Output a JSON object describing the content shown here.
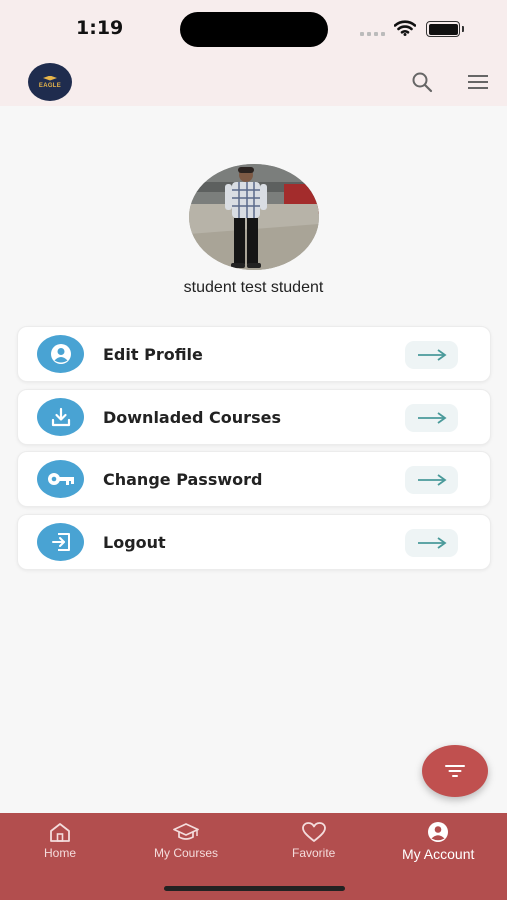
{
  "status_bar": {
    "time": "1:19"
  },
  "header": {
    "logo_text": "EAGLE",
    "search_icon": "search-icon",
    "menu_icon": "hamburger-menu-icon"
  },
  "profile": {
    "name": "student test student"
  },
  "menu": {
    "items": [
      {
        "label": "Edit Profile",
        "icon": "user-circle-icon"
      },
      {
        "label": "Downladed Courses",
        "icon": "download-icon"
      },
      {
        "label": "Change Password",
        "icon": "key-icon"
      },
      {
        "label": "Logout",
        "icon": "logout-icon"
      }
    ]
  },
  "fab": {
    "icon": "filter-icon"
  },
  "bottom_nav": {
    "items": [
      {
        "label": "Home",
        "icon": "home-icon"
      },
      {
        "label": "My Courses",
        "icon": "graduation-cap-icon"
      },
      {
        "label": "Favorite",
        "icon": "heart-icon"
      },
      {
        "label": "My Account",
        "icon": "account-icon"
      }
    ],
    "active": "My Account"
  },
  "colors": {
    "header_bg": "#f7eded",
    "accent_blue": "#49a3d3",
    "brand_red": "#b24e4e",
    "fab_red": "#c0504f",
    "arrow_teal": "#4a9a9a"
  }
}
